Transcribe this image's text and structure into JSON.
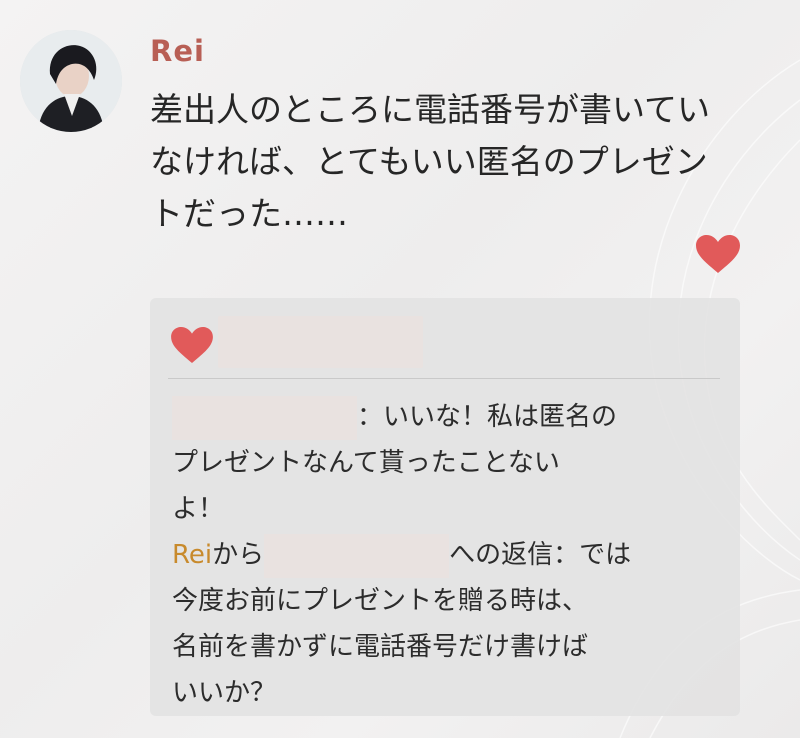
{
  "post": {
    "author": "Rei",
    "text_lines": [
      "差出人のところに電話番号が書いてい",
      "なければ、とてもいい匿名のプレゼン",
      "トだった……"
    ],
    "liked": true,
    "heart_color": "#e15a5a"
  },
  "comments": {
    "comment": {
      "text_line1": "：いいな！私は匿名の",
      "text_line2": "プレゼントなんて貰ったことない",
      "text_line3": "よ！"
    },
    "reply": {
      "author": "Rei",
      "from_suffix": "から",
      "to_suffix": "への返信：では",
      "text_line2": "今度お前にプレゼントを贈る時は、",
      "text_line3": "名前を書かずに電話番号だけ書けば",
      "text_line4": "いいか？"
    }
  },
  "colors": {
    "author_name": "#b85f55",
    "reply_author": "#c88a2c",
    "background": "#efeeee"
  }
}
